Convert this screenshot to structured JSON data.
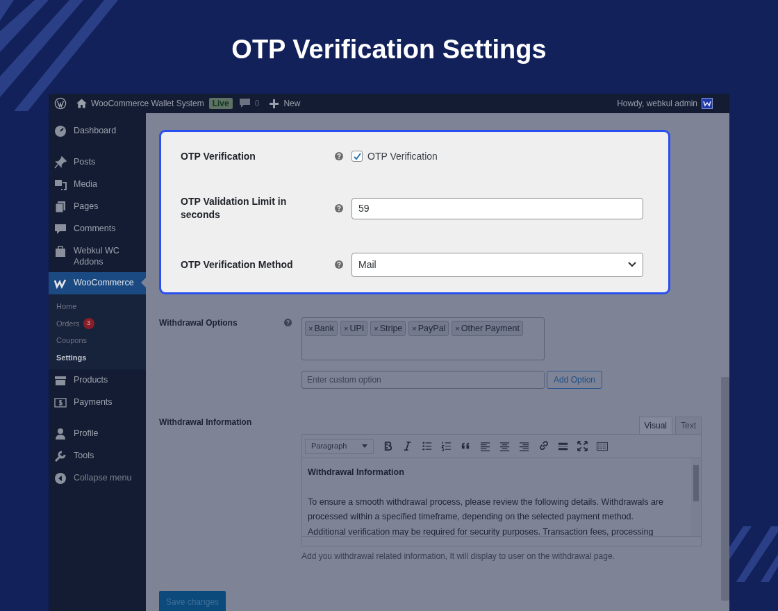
{
  "headline": "OTP Verification Settings",
  "admin_bar": {
    "site_name": "WooCommerce Wallet System",
    "live_badge": "Live",
    "comments_count": "0",
    "new_label": "New",
    "greeting": "Howdy, webkul admin"
  },
  "sidebar": {
    "groups": [
      [
        {
          "label": "Dashboard",
          "selected": false
        }
      ],
      [
        {
          "label": "Posts",
          "selected": false
        },
        {
          "label": "Media",
          "selected": false
        },
        {
          "label": "Pages",
          "selected": false
        },
        {
          "label": "Comments",
          "selected": false
        },
        {
          "label": "Webkul WC Addons",
          "selected": false
        },
        {
          "label": "WooCommerce",
          "selected": true,
          "children": [
            {
              "label": "Home",
              "selected": false
            },
            {
              "label": "Orders",
              "badge": "3",
              "selected": false
            },
            {
              "label": "Coupons",
              "selected": false
            },
            {
              "label": "Settings",
              "selected": true
            }
          ]
        },
        {
          "label": "Products",
          "selected": false
        },
        {
          "label": "Payments",
          "selected": false
        }
      ],
      [
        {
          "label": "Profile",
          "selected": false
        },
        {
          "label": "Tools",
          "selected": false
        },
        {
          "label": "Collapse menu",
          "kind": "collapse",
          "selected": false
        }
      ]
    ]
  },
  "otp_settings": [
    {
      "kind": "checkbox",
      "label": "OTP Verification",
      "checked": true,
      "option_label": "OTP Verification"
    },
    {
      "kind": "text",
      "label": "OTP Validation Limit in seconds",
      "value": "59"
    },
    {
      "kind": "select",
      "label": "OTP Verification Method",
      "value": "Mail"
    }
  ],
  "withdrawal_options": {
    "label": "Withdrawal Options",
    "tags": [
      "Bank",
      "UPI",
      "Stripe",
      "PayPal",
      "Other Payment"
    ],
    "remove_mark": "×",
    "custom_placeholder": "Enter custom option",
    "add_button": "Add Option"
  },
  "withdrawal_information": {
    "label": "Withdrawal Information",
    "tabs": [
      {
        "label": "Visual",
        "selected": true
      },
      {
        "label": "Text",
        "selected": false
      }
    ],
    "format": "Paragraph",
    "heading": "Withdrawal Information",
    "lines": [
      "To ensure a smooth withdrawal process, please review the following details. Withdrawals are",
      "processed within a specified timeframe, depending on the selected payment method.",
      "Additional verification may be required for security purposes. Transaction fees, processing"
    ],
    "hint": "Add you withdrawal related information, It will display to user on the withdrawal page."
  },
  "save_button": "Save changes"
}
